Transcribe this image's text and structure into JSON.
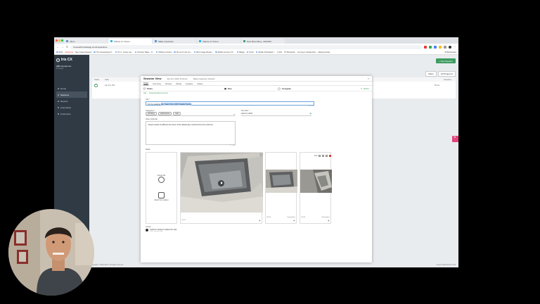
{
  "browser": {
    "tabs": [
      {
        "label": "Inbox",
        "active": false
      },
      {
        "label": "Videos on Vimeo",
        "active": true
      },
      {
        "label": "Make Inspection",
        "active": false
      },
      {
        "label": "Videos on Vimeo",
        "active": false
      },
      {
        "label": "New Recording - 3/4/2024",
        "active": false
      }
    ],
    "url": "homeorbit.trackapp.com/inspections",
    "bookmarks": [
      "ToDo",
      "Resolving",
      "New Linked Session",
      "The Accelerating P...",
      "TK II - Group Lay...",
      "Plumber Mater - O...",
      "Whitney's Notes",
      "Terms Of Use Go...",
      "Best Image Resize...",
      "Mobile & Accen-Th...",
      "Badge",
      "Fresh",
      "Mobile Scheduled l...",
      "Fresh",
      "ST Bookmark",
      "Coming to Update Mon",
      "Meeting Notes"
    ],
    "all_bookmarks": "All Bookmarks"
  },
  "sidebar": {
    "brand": "Iris CX",
    "org_name": "ABC Homes Co.",
    "org_sub": "11 Users",
    "items": [
      {
        "label": "Home",
        "active": false
      },
      {
        "label": "Sessions",
        "active": true
      },
      {
        "label": "Reports",
        "active": false
      },
      {
        "label": "Automation",
        "active": false
      },
      {
        "label": "Customers",
        "active": false
      }
    ]
  },
  "background": {
    "new_session": "+ New Session",
    "filters": [
      "Filters",
      "123 Project Id"
    ],
    "headers": [
      "Status",
      "Date",
      "Favorites"
    ],
    "row_date": "Apr 3rd, 202",
    "row_value": "SS 4A"
  },
  "footer": {
    "copyright": "Copyright © 2024 IrisCX. All rights reserved.",
    "version": "Version 2024-03-01 11:43"
  },
  "modal": {
    "title": "Session View",
    "date_info": "Apr 3rd, 2024 11:44 am",
    "subtitle": "Make Inspection Session",
    "tabs": [
      "Tasks",
      "Summary",
      "Review",
      "Media",
      "Analysis",
      "Safety"
    ],
    "active_tab": "Tasks",
    "task_col_label": "Tasks",
    "due_label": "Due",
    "assignee_label": "Assignee",
    "filter_label": "Filters",
    "subtabs": [
      "Add",
      "Existing Attachment Area"
    ],
    "title_label": "Title *",
    "title_prefix": "Fix the leaking ",
    "title_highlight": "tap. Seam the a RIG Sealed faucet",
    "title_count": "34 / 100",
    "tray_label": "Edit",
    "category_label": "Categories *",
    "categories": [
      "plumbing",
      "maintenance",
      "leak"
    ],
    "due_label_field": "Due Date *",
    "due_date": "April 13, 2024",
    "desc_label": "Notes (optional)",
    "desc_text": "Expert needs to address the issue of the leaking tap mentioned by the customer.",
    "desc_count": "77 / 1000",
    "media_label": "Media",
    "upload_file": "Upload File",
    "attach_gallery": "Attach from Gallery",
    "media": [
      {
        "time": "00:11",
        "type": ""
      },
      {
        "time": "00:14",
        "type": "Screenshot"
      },
      {
        "time": "01:20",
        "type": "Screenshot"
      }
    ],
    "activity_label": "Activity",
    "activity_text": "Guillermo Vazquez updated the task",
    "activity_time": "a few seconds ago"
  },
  "colors": {
    "accent": "#3d9b5f",
    "sidebar": "#2f3a45",
    "pink": "#e0457b",
    "delete": "#e53935"
  }
}
